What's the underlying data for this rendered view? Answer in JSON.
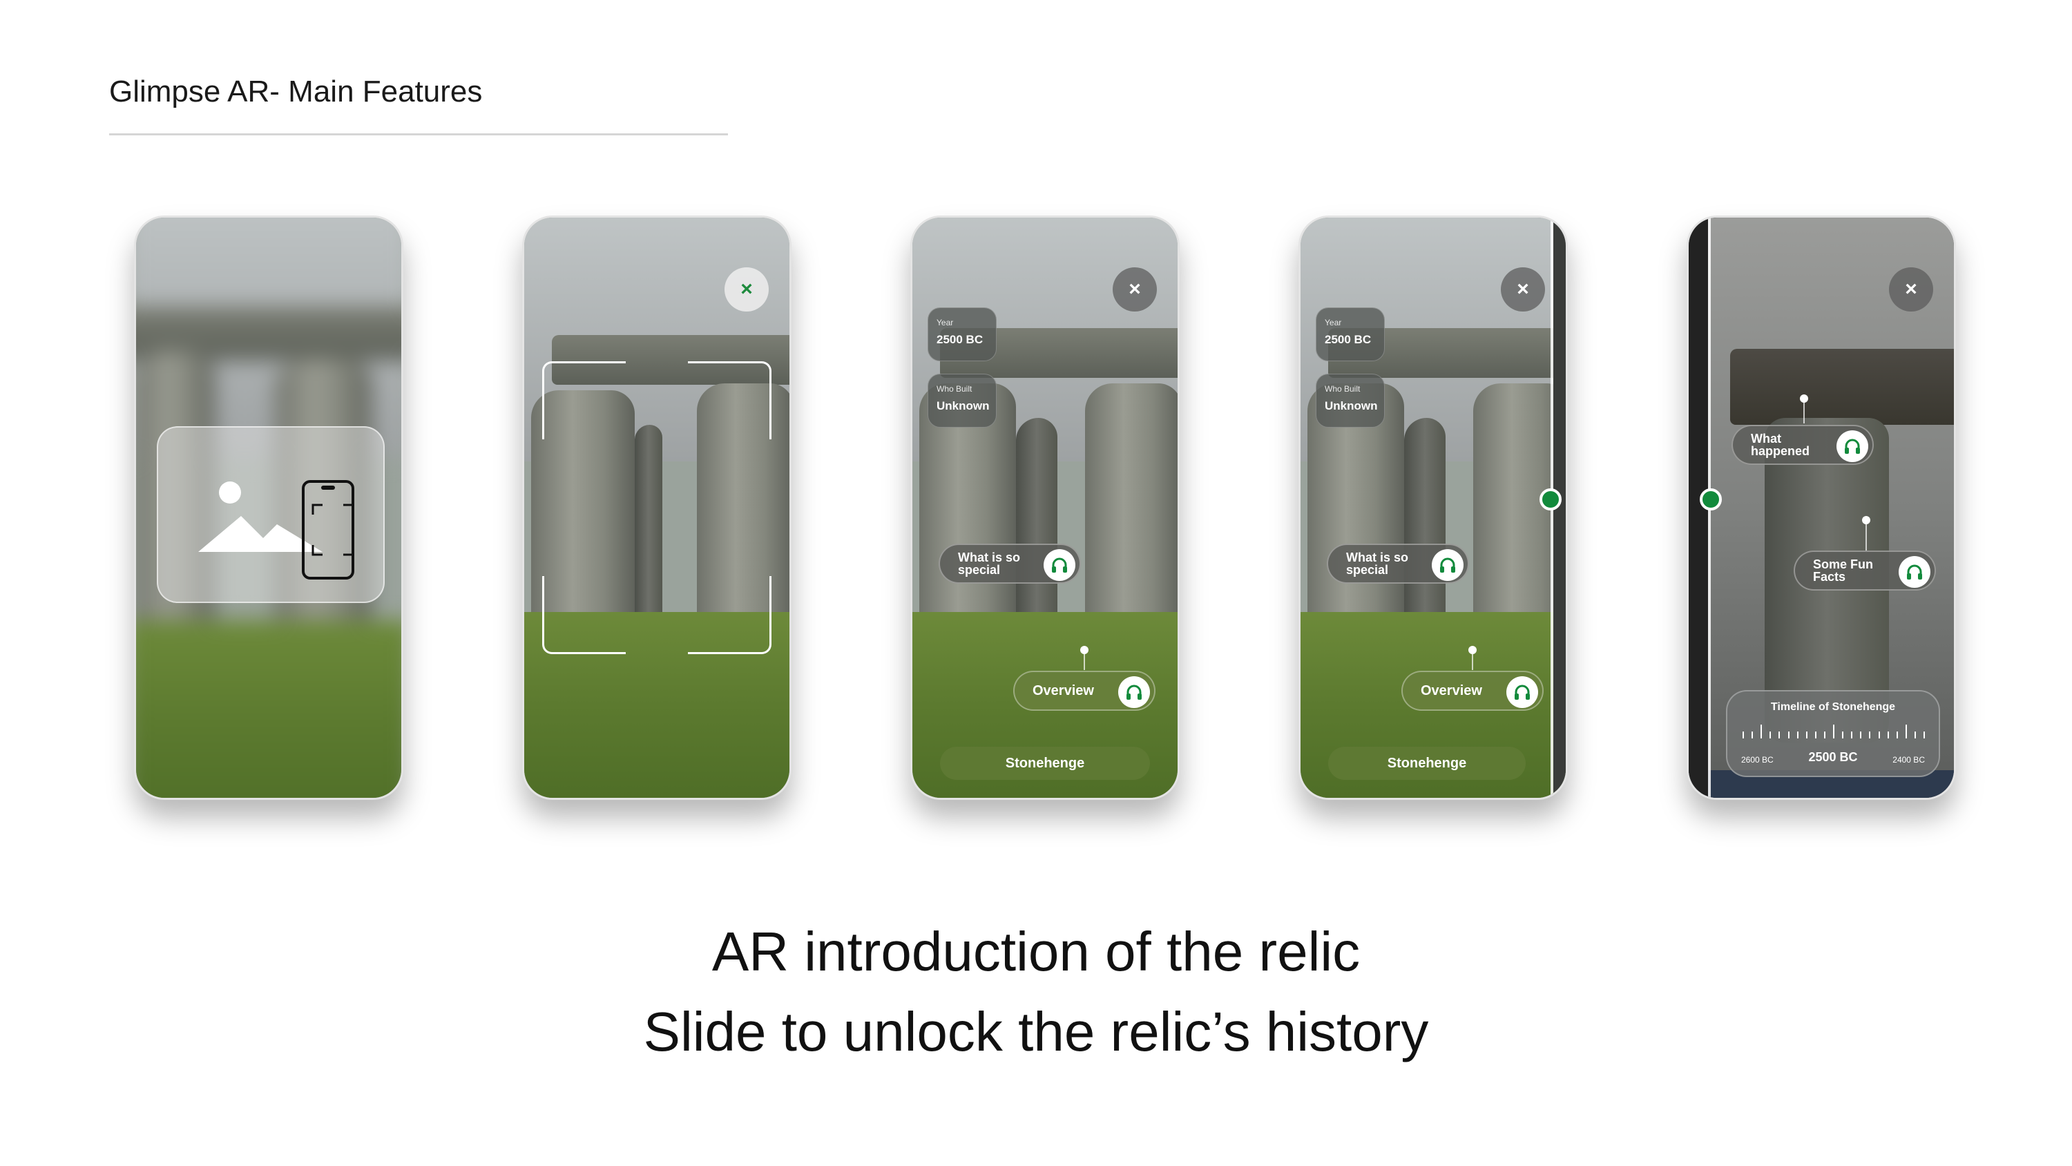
{
  "slide": {
    "title": "Glimpse AR- Main Features"
  },
  "phones": {
    "p1": {
      "icon": "image-scan-icon"
    },
    "p2": {
      "close": "×"
    },
    "p3": {
      "close": "×",
      "year_label": "Year",
      "year_value": "2500 BC",
      "builder_label": "Who Built",
      "builder_value": "Unknown",
      "special_label": "What is so special",
      "overview_label": "Overview",
      "name": "Stonehenge"
    },
    "p4": {
      "close": "×",
      "year_label": "Year",
      "year_value": "2500 BC",
      "builder_label": "Who Built",
      "builder_value": "Unknown",
      "special_label": "What is so special",
      "overview_label": "Overview",
      "name": "Stonehenge"
    },
    "p5": {
      "close": "×",
      "happened_label": "What happened",
      "facts_label": "Some Fun Facts",
      "timeline_title": "Timeline of Stonehenge",
      "timeline_start": "2600 BC",
      "timeline_current": "2500 BC",
      "timeline_end": "2400 BC"
    }
  },
  "captions": {
    "line1": "AR introduction of the relic",
    "line2": "Slide to unlock the relic’s history"
  },
  "colors": {
    "accent_green": "#128a3c",
    "pill_green": "#68803c"
  }
}
